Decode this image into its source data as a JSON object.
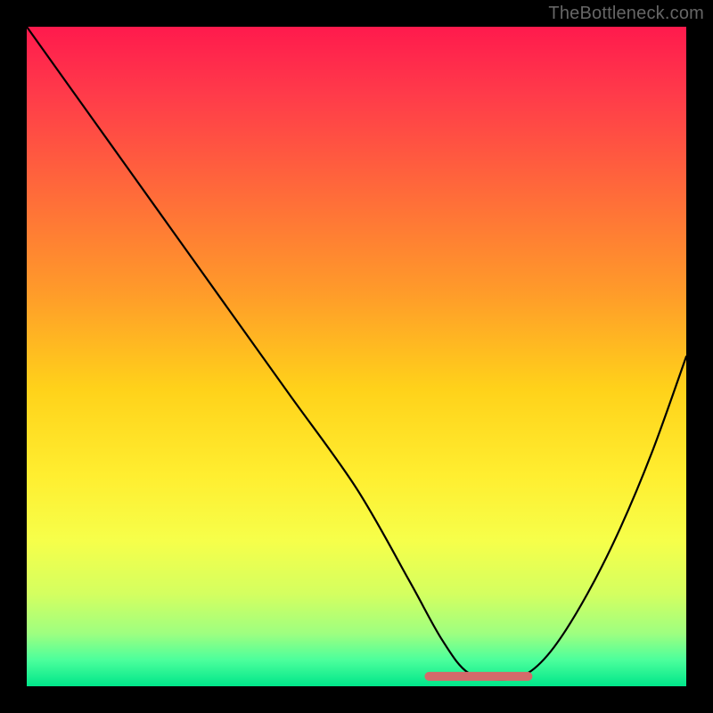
{
  "watermark": "TheBottleneck.com",
  "chart_data": {
    "type": "line",
    "title": "",
    "xlabel": "",
    "ylabel": "",
    "xlim": [
      0,
      100
    ],
    "ylim": [
      0,
      100
    ],
    "grid": false,
    "legend": false,
    "background_gradient": {
      "top": "#ff1a4d",
      "bottom": "#00e68a",
      "meaning": "red-high to green-low"
    },
    "series": [
      {
        "name": "curve",
        "color": "#000000",
        "x": [
          0,
          10,
          20,
          30,
          40,
          50,
          58,
          63,
          67,
          72,
          76,
          80,
          85,
          90,
          95,
          100
        ],
        "values": [
          100,
          86,
          72,
          58,
          44,
          30,
          16,
          7,
          2,
          1,
          2,
          6,
          14,
          24,
          36,
          50
        ]
      }
    ],
    "valley_highlight": {
      "color": "#d46a6a",
      "x_start": 61,
      "x_end": 76,
      "y": 1.5
    }
  }
}
